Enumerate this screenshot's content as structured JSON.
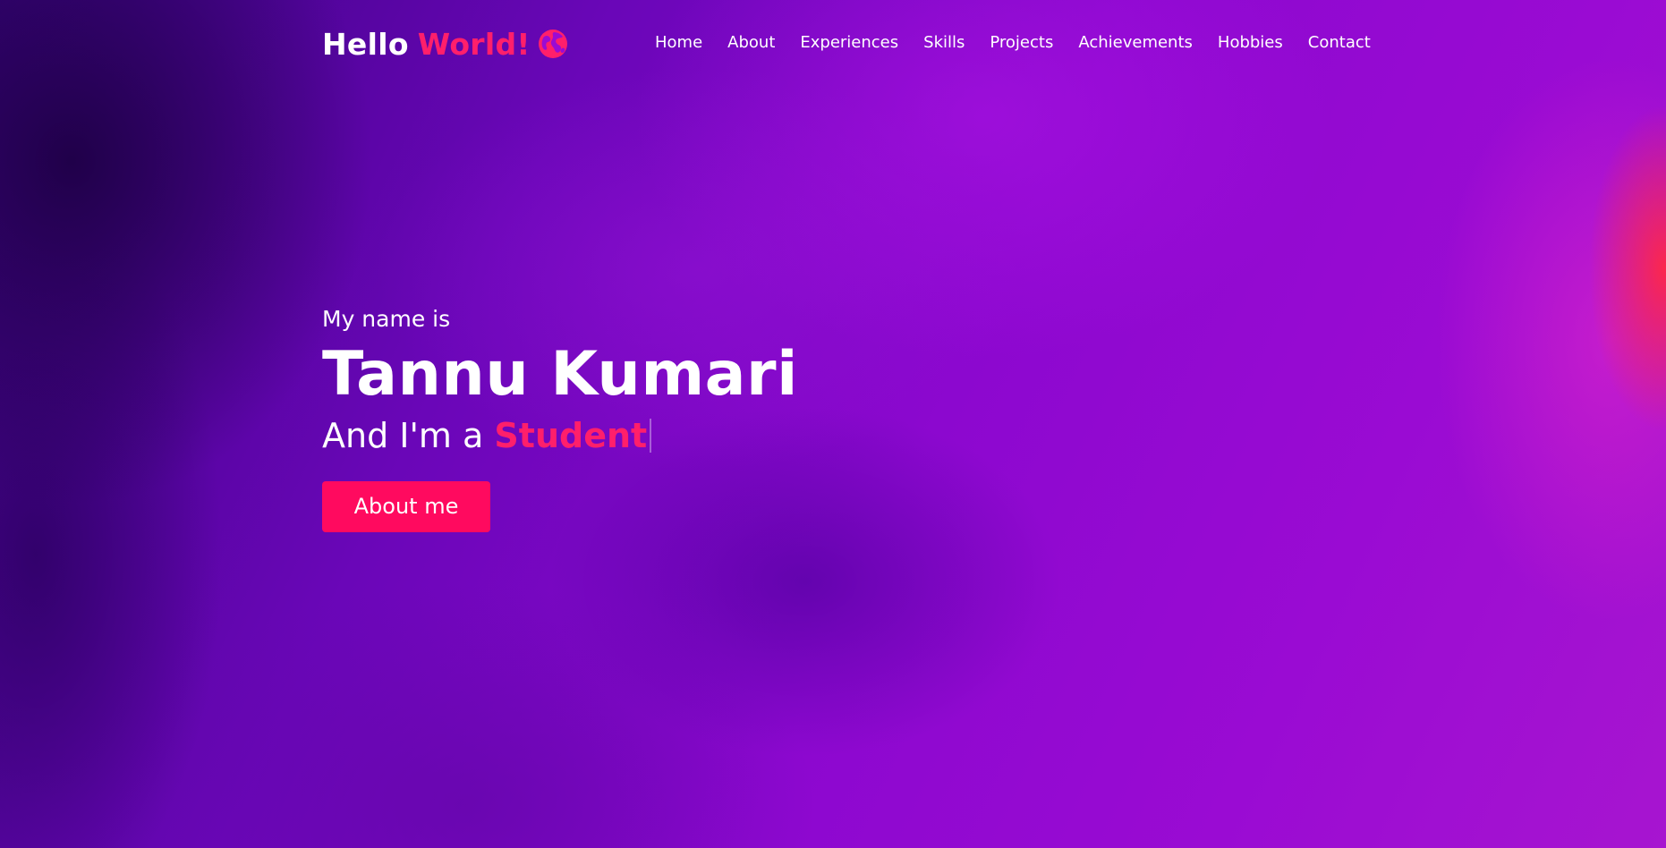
{
  "header": {
    "logo": {
      "text": "Hello",
      "accent": "World!",
      "icon": "globe-icon"
    },
    "nav": [
      {
        "label": "Home"
      },
      {
        "label": "About"
      },
      {
        "label": "Experiences"
      },
      {
        "label": "Skills"
      },
      {
        "label": "Projects"
      },
      {
        "label": "Achievements"
      },
      {
        "label": "Hobbies"
      },
      {
        "label": "Contact"
      }
    ]
  },
  "hero": {
    "intro": "My name is",
    "name": "Tannu Kumari",
    "role_prefix": "And I'm a",
    "role": "Student",
    "cta_label": "About me"
  },
  "colors": {
    "accent": "#ff1f6b",
    "button": "#ff0a5f",
    "text": "#ffffff",
    "background_primary": "#8c08cf"
  }
}
